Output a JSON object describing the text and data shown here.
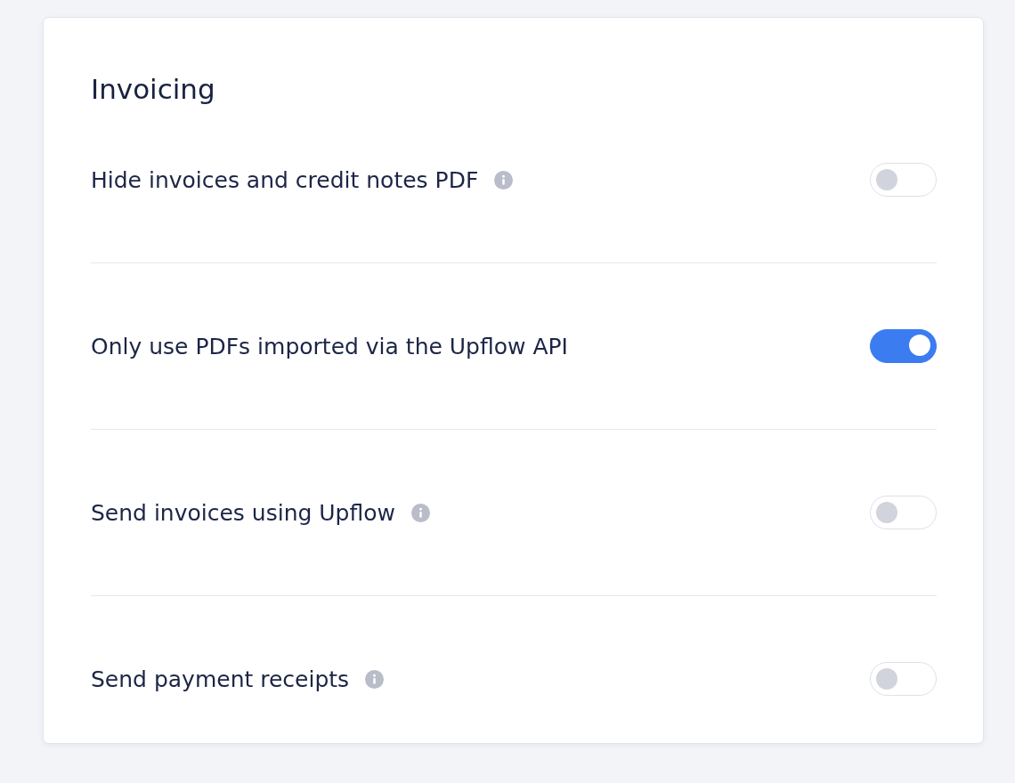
{
  "section": {
    "title": "Invoicing"
  },
  "settings": [
    {
      "label": "Hide invoices and credit notes PDF",
      "info": true,
      "on": false
    },
    {
      "label": "Only use PDFs imported via the Upflow API",
      "info": false,
      "on": true
    },
    {
      "label": "Send invoices using Upflow",
      "info": true,
      "on": false
    },
    {
      "label": "Send payment receipts",
      "info": true,
      "on": false
    }
  ]
}
